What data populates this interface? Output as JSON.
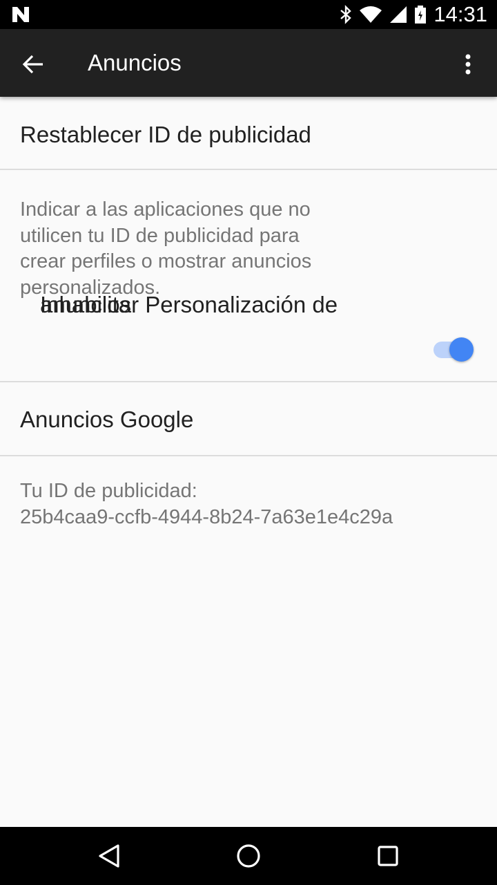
{
  "status_bar": {
    "time": "14:31",
    "icons": [
      "notification-n-icon",
      "bluetooth-icon",
      "wifi-icon",
      "signal-icon",
      "battery-icon"
    ]
  },
  "app_bar": {
    "title": "Anuncios",
    "back_icon": "arrow-back-icon",
    "overflow_icon": "more-vert-icon"
  },
  "preferences": {
    "reset_id": {
      "title": "Restablecer ID de publicidad"
    },
    "opt_out": {
      "title_line1": "Inhabilitar Personalización de",
      "title_line2": "anuncios",
      "summary_line1": "Indicar a las aplicaciones que no",
      "summary_line2": "utilicen tu ID de publicidad para",
      "summary_line3": "crear perfiles o mostrar anuncios",
      "summary_line4": "personalizados.",
      "switch_on": true
    },
    "google_ads": {
      "title": "Anuncios Google"
    }
  },
  "advertising_id": {
    "label": "Tu ID de publicidad:",
    "value": "25b4caa9-ccfb-4944-8b24-7a63e1e4c29a"
  },
  "nav_bar": {
    "back_icon": "nav-back-icon",
    "home_icon": "nav-home-icon",
    "recents_icon": "nav-recents-icon"
  },
  "colors": {
    "accent": "#4285f4",
    "app_bar": "#212121",
    "background": "#fafafa"
  }
}
